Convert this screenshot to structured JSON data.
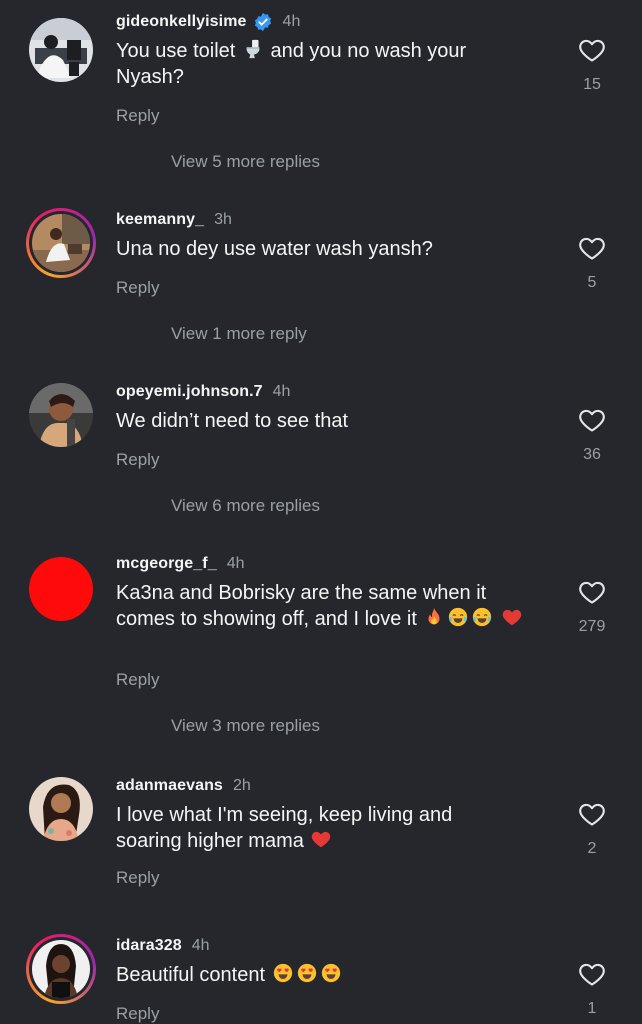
{
  "colors": {
    "background": "#25272c",
    "text_primary": "#f5f5f5",
    "text_secondary": "#9aa0a6",
    "verified_blue": "#3897f0",
    "story_ring": "#e91e63"
  },
  "comments": [
    {
      "username": "gideonkellyisime",
      "verified": true,
      "time": "4h",
      "text_before": "You use toilet",
      "text_after": "and you no wash your Nyash?",
      "inline_emoji": "toilet-emoji",
      "reply_label": "Reply",
      "view_more": "View 5 more replies",
      "like_count": "15"
    },
    {
      "username": "keemanny_",
      "time": "3h",
      "text": "Una no dey use water wash yansh?",
      "reply_label": "Reply",
      "view_more": "View 1 more reply",
      "like_count": "5"
    },
    {
      "username": "opeyemi.johnson.7",
      "time": "4h",
      "text": "We didn’t need to see that",
      "reply_label": "Reply",
      "view_more": "View 6 more replies",
      "like_count": "36"
    },
    {
      "username": "mcgeorge_f_",
      "time": "4h",
      "text": "Ka3na and Bobrisky are the same when it comes to showing off, and I love it",
      "trailing_emojis": [
        "fire-emoji",
        "tears-of-joy-emoji",
        "tears-of-joy-emoji",
        "red-heart-emoji"
      ],
      "reply_label": "Reply",
      "view_more": "View 3 more replies",
      "like_count": "279"
    },
    {
      "username": "adanmaevans",
      "time": "2h",
      "text": "I love what I'm seeing, keep living and soaring higher mama",
      "trailing_emojis": [
        "red-heart-emoji"
      ],
      "reply_label": "Reply",
      "like_count": "2"
    },
    {
      "username": "idara328",
      "time": "4h",
      "text": "Beautiful content",
      "trailing_emojis": [
        "heart-eyes-emoji",
        "heart-eyes-emoji",
        "heart-eyes-emoji"
      ],
      "reply_label": "Reply",
      "like_count": "1"
    }
  ]
}
